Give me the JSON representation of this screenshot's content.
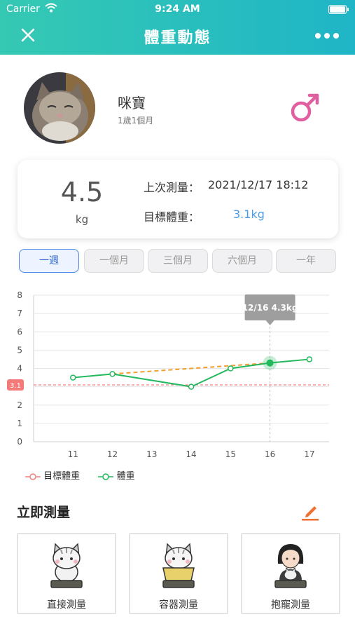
{
  "status_bar": {
    "carrier": "Carrier",
    "time": "9:24 AM"
  },
  "nav": {
    "title": "體重動態",
    "close_icon": "close-icon",
    "more_icon": "more-icon"
  },
  "pet": {
    "name": "咪寶",
    "age": "1歲1個月",
    "gender": "male",
    "gender_color": "#e05fa0"
  },
  "summary": {
    "weight": "4.5",
    "unit": "kg",
    "last_label": "上次測量：",
    "last_value": "2021/12/17 18:12",
    "target_label": "目標體重：",
    "target_value": "3.1kg"
  },
  "range_tabs": [
    {
      "label": "一週",
      "active": true
    },
    {
      "label": "一個月",
      "active": false
    },
    {
      "label": "三個月",
      "active": false
    },
    {
      "label": "六個月",
      "active": false
    },
    {
      "label": "一年",
      "active": false
    }
  ],
  "chart_data": {
    "type": "line",
    "x": [
      "11",
      "12",
      "13",
      "14",
      "15",
      "16",
      "17"
    ],
    "ylim": [
      0,
      8
    ],
    "y_ticks": [
      "0",
      "1",
      "2",
      "3",
      "4",
      "5",
      "6",
      "7",
      "8"
    ],
    "series": [
      {
        "name": "體重",
        "color": "#22b85c",
        "x": [
          11,
          12,
          14,
          15,
          16,
          17
        ],
        "values": [
          3.5,
          3.7,
          3.0,
          4.0,
          4.3,
          4.5
        ]
      }
    ],
    "target": {
      "name": "目標體重",
      "value": 3.1,
      "label": "3.1",
      "color": "#f08080"
    },
    "trend": {
      "x": [
        12,
        16
      ],
      "values": [
        3.7,
        4.3
      ],
      "color": "#f0a030"
    },
    "tooltip": {
      "x": 16,
      "text": "12/16 4.3kg"
    },
    "grid": true
  },
  "legend": {
    "target": "目標體重",
    "weight": "體重"
  },
  "measure": {
    "title": "立即測量",
    "methods": [
      {
        "label": "直接測量"
      },
      {
        "label": "容器測量"
      },
      {
        "label": "抱寵測量"
      }
    ]
  },
  "colors": {
    "header": "#2bbfbd",
    "accent": "#4a86e8",
    "edit": "#f07030"
  }
}
